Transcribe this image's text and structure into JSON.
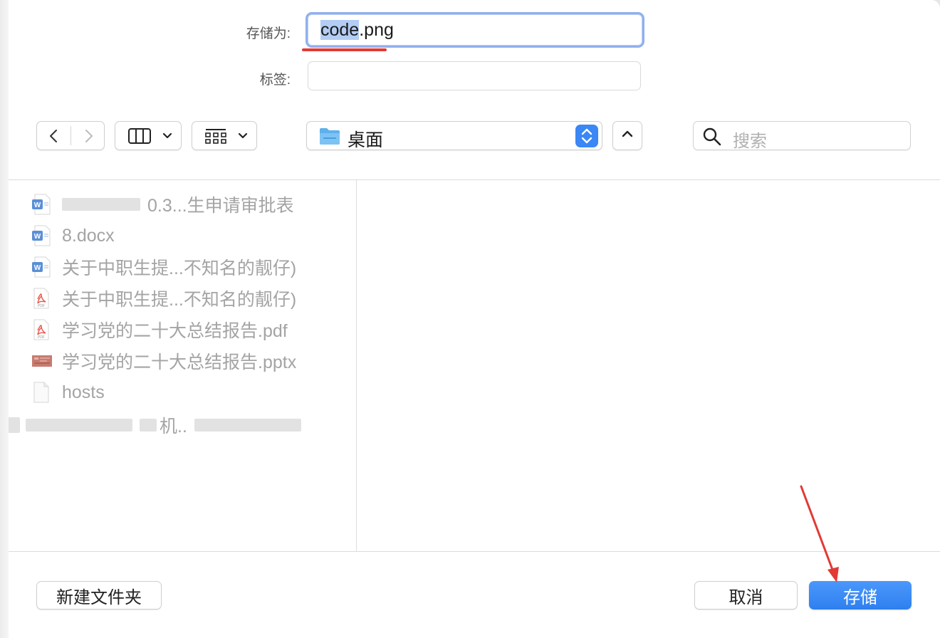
{
  "dialog": {
    "save_as_label": "存储为:",
    "tags_label": "标签:",
    "filename_selected": "code",
    "filename_rest": ".png",
    "tags_value": ""
  },
  "toolbar": {
    "back_icon": "chevron-left-icon",
    "forward_icon": "chevron-right-icon",
    "view_columns_icon": "columns-icon",
    "view_grid_icon": "grid-icon",
    "location_label": "桌面",
    "search_placeholder": "搜索"
  },
  "files": [
    {
      "name": "0.3...生申请审批表",
      "type": "word",
      "redacted_prefix": true
    },
    {
      "name": "8.docx",
      "type": "word"
    },
    {
      "name": "关于中职生提...不知名的靓仔)",
      "type": "word"
    },
    {
      "name": "关于中职生提...不知名的靓仔)",
      "type": "pdf"
    },
    {
      "name": "学习党的二十大总结报告.pdf",
      "type": "pdf"
    },
    {
      "name": "学习党的二十大总结报告.pptx",
      "type": "pptx"
    },
    {
      "name": "hosts",
      "type": "plain"
    },
    {
      "name": "机..",
      "type": "redacted"
    }
  ],
  "footer": {
    "new_folder_label": "新建文件夹",
    "cancel_label": "取消",
    "save_label": "存储"
  },
  "colors": {
    "accent": "#3a87f5",
    "annotation_red": "#e23a35"
  }
}
